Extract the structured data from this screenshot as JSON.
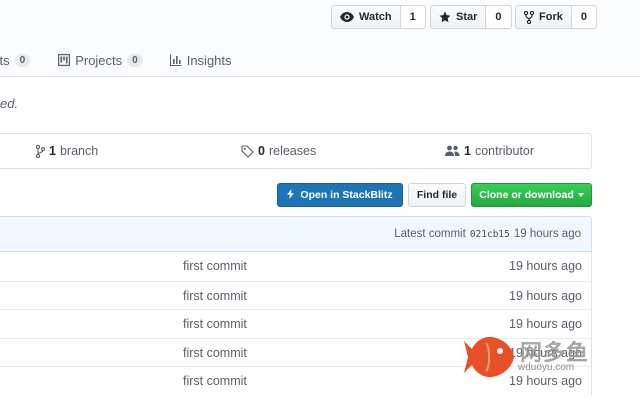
{
  "social": {
    "watch": {
      "label": "Watch",
      "count": "1"
    },
    "star": {
      "label": "Star",
      "count": "0"
    },
    "fork": {
      "label": "Fork",
      "count": "0"
    }
  },
  "tabs": [
    {
      "label": "sts",
      "counter": "0",
      "icon": "pull-request-icon"
    },
    {
      "label": "Projects",
      "counter": "0",
      "icon": "project-icon"
    },
    {
      "label": "Insights",
      "counter": "",
      "icon": "graph-icon"
    }
  ],
  "description": "ed.",
  "summary": {
    "branch": {
      "count": "1",
      "label": "branch"
    },
    "releases": {
      "count": "0",
      "label": "releases"
    },
    "contributors": {
      "count": "1",
      "label": "contributor"
    }
  },
  "actions": {
    "stackblitz": "Open in StackBlitz",
    "find_file": "Find file",
    "clone": "Clone or download"
  },
  "latest_commit": {
    "prefix": "Latest commit",
    "sha": "021cb15",
    "age": "19 hours ago"
  },
  "files": [
    {
      "message": "first commit",
      "age": "19 hours ago"
    },
    {
      "message": "first commit",
      "age": "19 hours ago"
    },
    {
      "message": "first commit",
      "age": "19 hours ago"
    },
    {
      "message": "first commit",
      "age": "19 hours ago"
    },
    {
      "message": "first commit",
      "age": "19 hours ago"
    }
  ],
  "watermark": {
    "cn": "网多鱼",
    "en": "wduoyu.com"
  },
  "colors": {
    "stackblitz": "#1f74b6",
    "clone_green": "#28a745",
    "commit_bar": "#f1f8ff",
    "watermark_fish": "#e8502a"
  }
}
